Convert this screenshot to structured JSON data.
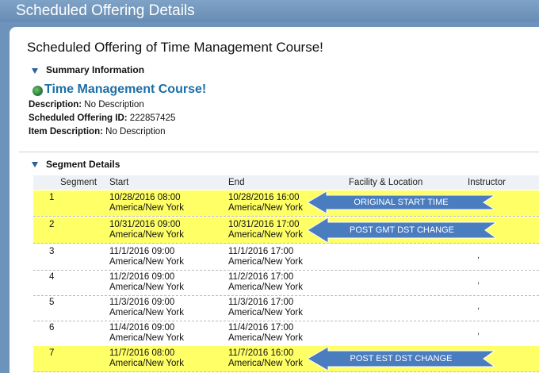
{
  "window": {
    "title": "Scheduled Offering Details"
  },
  "page_title": "Scheduled Offering of Time Management Course!",
  "summary": {
    "section_label": "Summary Information",
    "course_name": "Time Management Course!",
    "description_label": "Description:",
    "description_value": "No Description",
    "offering_id_label": "Scheduled Offering ID:",
    "offering_id_value": "222857425",
    "item_desc_label": "Item Description:",
    "item_desc_value": "No Description"
  },
  "segments": {
    "section_label": "Segment Details",
    "columns": [
      "Segment",
      "Start",
      "End",
      "Facility & Location",
      "Instructor"
    ],
    "rows": [
      {
        "segment": "1",
        "start_date": "10/28/2016 08:00",
        "start_tz": "America/New York",
        "end_date": "10/28/2016 16:00",
        "end_tz": "America/New York",
        "instructor": ""
      },
      {
        "segment": "2",
        "start_date": "10/31/2016 09:00",
        "start_tz": "America/New York",
        "end_date": "10/31/2016 17:00",
        "end_tz": "America/New York",
        "instructor": ""
      },
      {
        "segment": "3",
        "start_date": "11/1/2016 09:00",
        "start_tz": "America/New York",
        "end_date": "11/1/2016 17:00",
        "end_tz": "America/New York",
        "instructor": ","
      },
      {
        "segment": "4",
        "start_date": "11/2/2016 09:00",
        "start_tz": "America/New York",
        "end_date": "11/2/2016 17:00",
        "end_tz": "America/New York",
        "instructor": ","
      },
      {
        "segment": "5",
        "start_date": "11/3/2016 09:00",
        "start_tz": "America/New York",
        "end_date": "11/3/2016 17:00",
        "end_tz": "America/New York",
        "instructor": ","
      },
      {
        "segment": "6",
        "start_date": "11/4/2016 09:00",
        "start_tz": "America/New York",
        "end_date": "11/4/2016 17:00",
        "end_tz": "America/New York",
        "instructor": ","
      },
      {
        "segment": "7",
        "start_date": "11/7/2016 08:00",
        "start_tz": "America/New York",
        "end_date": "11/7/2016 16:00",
        "end_tz": "America/New York",
        "instructor": ""
      }
    ]
  },
  "annotations": [
    "ORIGINAL START TIME",
    "POST GMT DST CHANGE",
    "POST EST DST CHANGE"
  ],
  "colors": {
    "highlight": "#ffff66",
    "callout": "#4a7cc0",
    "title_bar": "#6e93ba",
    "link": "#1a6ea8"
  },
  "icons": {
    "section_toggle": "triangle-down-icon",
    "course": "globe-icon"
  }
}
